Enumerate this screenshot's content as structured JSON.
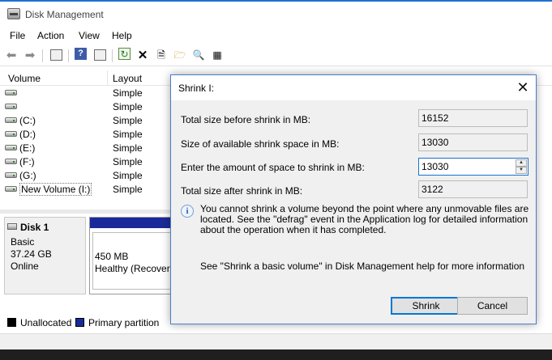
{
  "window": {
    "title": "Disk Management"
  },
  "menu": [
    "File",
    "Action",
    "View",
    "Help"
  ],
  "toolbar": {
    "icons": [
      "back-arrow-icon",
      "forward-arrow-icon",
      "console-tree-icon",
      "help-icon",
      "show-hide-icon",
      "refresh-icon",
      "delete-icon",
      "properties-icon",
      "open-icon",
      "explore-icon",
      "rescan-icon"
    ]
  },
  "volume_table": {
    "columns": [
      "Volume",
      "Layout"
    ],
    "rows": [
      {
        "volume": "",
        "layout": "Simple"
      },
      {
        "volume": "",
        "layout": "Simple"
      },
      {
        "volume": "(C:)",
        "layout": "Simple"
      },
      {
        "volume": "(D:)",
        "layout": "Simple"
      },
      {
        "volume": "(E:)",
        "layout": "Simple"
      },
      {
        "volume": "(F:)",
        "layout": "Simple"
      },
      {
        "volume": "(G:)",
        "layout": "Simple"
      },
      {
        "volume": "New Volume (I:)",
        "layout": "Simple"
      }
    ]
  },
  "disk": {
    "name": "Disk 1",
    "type": "Basic",
    "size": "37.24 GB",
    "status": "Online",
    "partition_size": "450 MB",
    "partition_status": "Healthy (Recovery"
  },
  "legend": [
    {
      "label": "Unallocated",
      "color": "#000000"
    },
    {
      "label": "Primary partition",
      "color": "#1a2a9a"
    }
  ],
  "dialog": {
    "title": "Shrink I:",
    "rows": {
      "total_before_label": "Total size before shrink in MB:",
      "total_before_value": "16152",
      "available_label": "Size of available shrink space in MB:",
      "available_value": "13030",
      "enter_label": "Enter the amount of space to shrink in MB:",
      "enter_value": "13030",
      "total_after_label": "Total size after shrink in MB:",
      "total_after_value": "3122"
    },
    "info_text": "You cannot shrink a volume beyond the point where any unmovable files are located. See the \"defrag\" event in the Application log for detailed information about the operation when it has completed.",
    "help_text": "See \"Shrink a basic volume\" in Disk Management help for more information",
    "shrink_button": "Shrink",
    "cancel_button": "Cancel"
  }
}
